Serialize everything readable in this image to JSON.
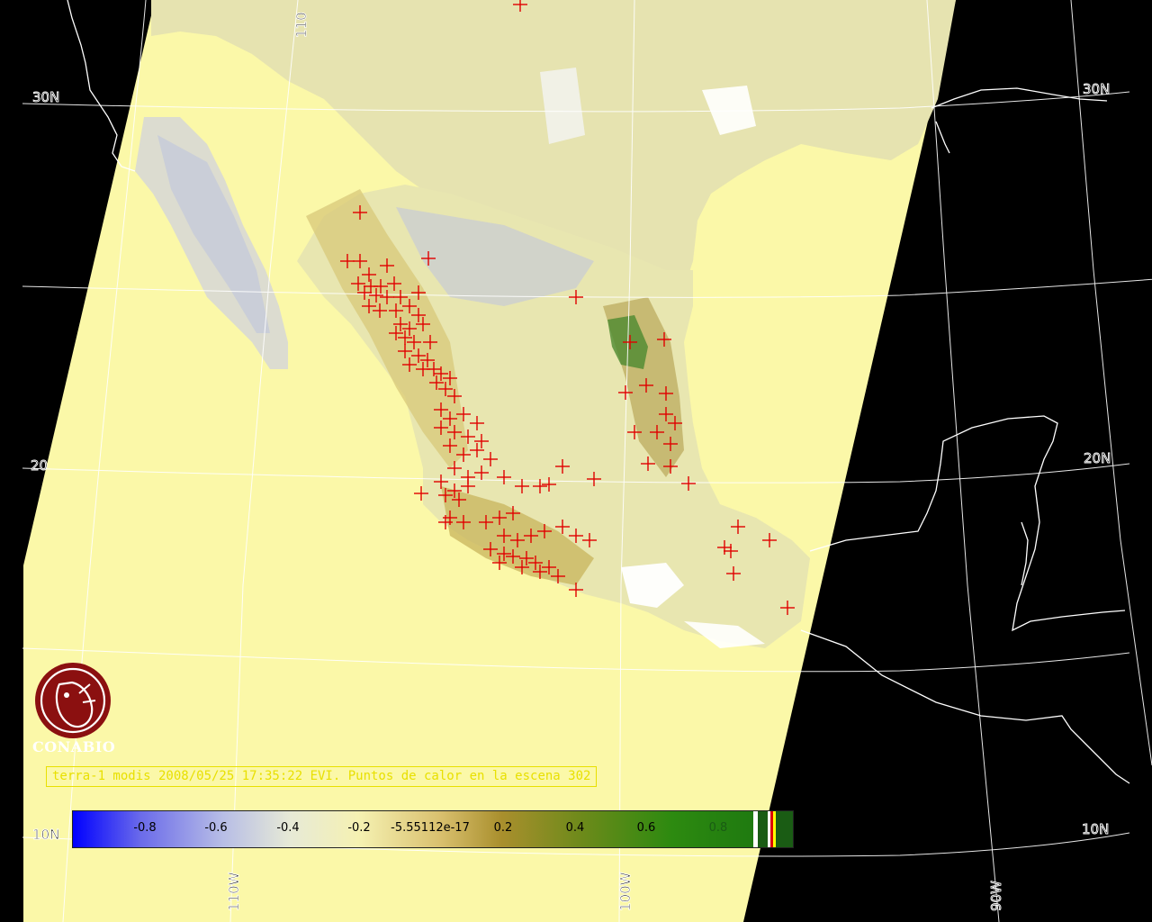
{
  "map": {
    "title": "terra-1 modis 2008/05/25 17:35:22 EVI. Puntos de calor en la escena 302",
    "institution": "CONABIO",
    "layer": "EVI",
    "overlay": "hot spots (red crosses)",
    "graticule_labels": {
      "lat_30": "30N",
      "lat_30_right": "30N",
      "lat_20": "20",
      "lat_20_right": "20N",
      "lat_10": "10N",
      "lat_10_left": "10N",
      "lon_110": "110W",
      "lon_100": "100W",
      "lon_90": "90W",
      "top_lon": "110"
    },
    "colorbar": {
      "ticks": [
        "-0.8",
        "-0.6",
        "-0.4",
        "-0.2",
        "-5.55112e-17",
        "0.2",
        "0.4",
        "0.6",
        "0.8"
      ],
      "colors": [
        "#0000ff",
        "#b7bde6",
        "#f5f1b2",
        "#a98f2d",
        "#1f7a10"
      ]
    }
  }
}
